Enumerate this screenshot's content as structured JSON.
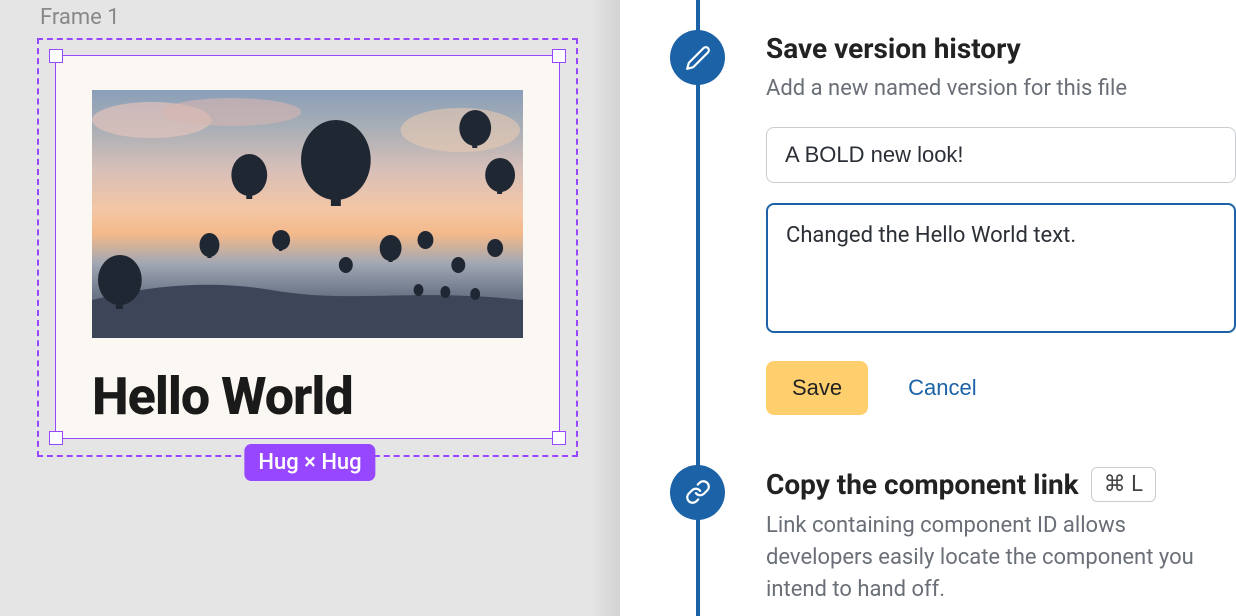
{
  "canvas": {
    "frame_label": "Frame 1",
    "card_title": "Hello World",
    "size_chip": "Hug × Hug",
    "image_alt": "hot-air-balloons-at-sunset"
  },
  "timeline": {
    "step1": {
      "title": "Save version history",
      "description": "Add a new named version for this file",
      "name_input": "A BOLD new look!",
      "desc_input": "Changed the Hello World text.",
      "save_label": "Save",
      "cancel_label": "Cancel"
    },
    "step2": {
      "title": "Copy the component link",
      "shortcut": "⌘ L",
      "description": "Link containing component ID allows developers easily locate the component you intend to hand off."
    }
  }
}
